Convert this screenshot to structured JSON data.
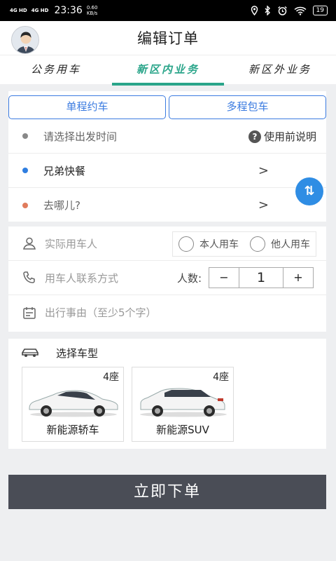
{
  "status_bar": {
    "signal_1": "4G HD",
    "signal_2": "4G HD",
    "time": "23:36",
    "speed_value": "0.60",
    "speed_unit": "KB/s",
    "battery": "19"
  },
  "header": {
    "title": "编辑订单"
  },
  "tabs": [
    {
      "label": "公务用车",
      "active": false
    },
    {
      "label": "新区内业务",
      "active": true
    },
    {
      "label": "新区外业务",
      "active": false
    }
  ],
  "trip_type": {
    "single": "单程约车",
    "multi": "多程包车"
  },
  "departure_time": {
    "placeholder": "请选择出发时间",
    "help": "使用前说明",
    "help_icon": "?"
  },
  "origin": {
    "value": "兄弟快餐",
    "chevron": ">"
  },
  "destination": {
    "placeholder": "去哪儿?",
    "chevron": ">"
  },
  "swap_icon": "⇅",
  "passenger": {
    "placeholder": "实际用车人",
    "option_self": "本人用车",
    "option_other": "他人用车"
  },
  "contact": {
    "placeholder": "用车人联系方式",
    "count_label": "人数:",
    "minus": "−",
    "count_value": "1",
    "plus": "+"
  },
  "reason": {
    "placeholder": "出行事由（至少5个字）"
  },
  "vehicle": {
    "title": "选择车型",
    "options": [
      {
        "seats": "4座",
        "name": "新能源轿车"
      },
      {
        "seats": "4座",
        "name": "新能源SUV"
      }
    ]
  },
  "submit": {
    "label": "立即下单"
  },
  "colors": {
    "accent_green": "#2aa58a",
    "accent_blue": "#3b7be0",
    "swap_blue": "#2f8de4",
    "submit_bg": "#4a4d56"
  }
}
